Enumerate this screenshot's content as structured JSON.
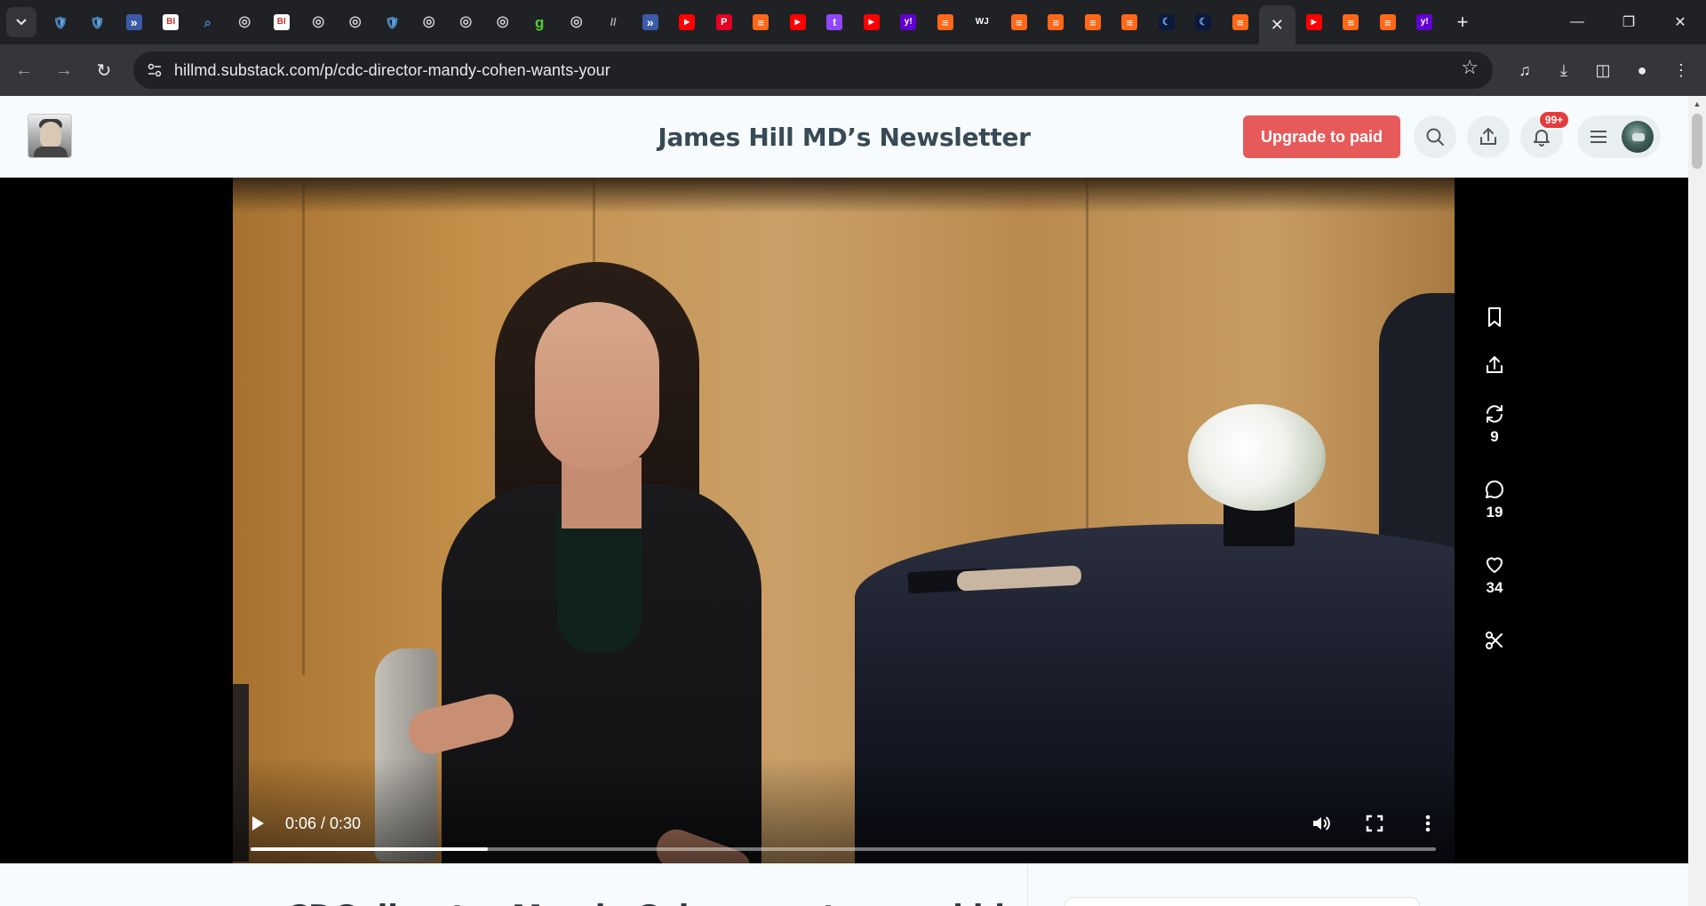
{
  "browser": {
    "url": "hillmd.substack.com/p/cdc-director-mandy-cohen-wants-your",
    "tab_favicons": [
      "shield-icon",
      "shield-icon",
      "arrow-icon",
      "bi-icon",
      "search-icon",
      "globe-icon",
      "bi-icon",
      "globe-icon",
      "globe-icon",
      "shield-icon",
      "globe-icon",
      "globe-icon",
      "globe-icon",
      "g-icon",
      "globe-icon",
      "pen-icon",
      "arrow-icon",
      "youtube-icon",
      "pin-icon",
      "bookmark-icon",
      "youtube-icon",
      "twitch-icon",
      "youtube-icon",
      "yahoo-icon",
      "bookmark-icon",
      "wsj-icon",
      "bookmark-icon",
      "bookmark-icon",
      "bookmark-icon",
      "bookmark-icon",
      "moon-icon",
      "moon-icon",
      "bookmark-icon",
      "close-icon",
      "youtube-icon",
      "bookmark-icon",
      "bookmark-icon",
      "yahoo-icon"
    ],
    "colors": {
      "tabbar": "#202124",
      "toolbar": "#35363a"
    }
  },
  "header": {
    "title": "James Hill MD’s Newsletter",
    "upgrade_label": "Upgrade to paid",
    "notification_badge": "99+",
    "accent": "#e75a5a"
  },
  "video": {
    "time": "0:06 / 0:30",
    "progress": 0.2
  },
  "actions": {
    "restacks": "9",
    "comments": "19",
    "likes": "34"
  },
  "post": {
    "title": "CDC director Mandy Cohen wants your kids"
  }
}
